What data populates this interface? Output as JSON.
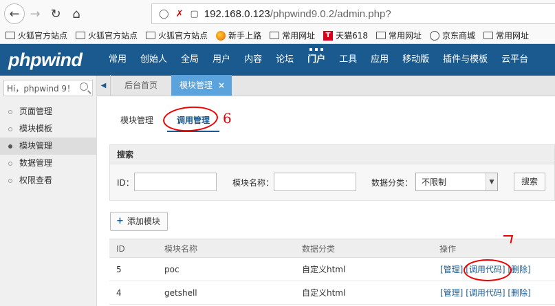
{
  "browser": {
    "url_host": "192.168.0.123",
    "url_path": "/phpwind9.0.2/admin.php?",
    "bookmarks": [
      {
        "label": "火狐官方站点",
        "icon": "folder-icon"
      },
      {
        "label": "火狐官方站点",
        "icon": "folder-icon"
      },
      {
        "label": "火狐官方站点",
        "icon": "folder-icon"
      },
      {
        "label": "新手上路",
        "icon": "firefox-icon"
      },
      {
        "label": "常用网址",
        "icon": "folder-icon"
      },
      {
        "label": "天猫618",
        "icon": "tmall-icon"
      },
      {
        "label": "常用网址",
        "icon": "folder-icon"
      },
      {
        "label": "京东商城",
        "icon": "globe-icon"
      },
      {
        "label": "常用网址",
        "icon": "folder-icon"
      }
    ]
  },
  "header": {
    "logo": "phpwind",
    "nav": [
      "常用",
      "创始人",
      "全局",
      "用户",
      "内容",
      "论坛",
      "门户",
      "工具",
      "应用",
      "移动版",
      "插件与模板",
      "云平台"
    ],
    "active_nav": "门户"
  },
  "sidebar": {
    "search_value": "Hi，phpwind 9！",
    "items": [
      {
        "label": "页面管理"
      },
      {
        "label": "模块模板"
      },
      {
        "label": "模块管理",
        "active": true
      },
      {
        "label": "数据管理"
      },
      {
        "label": "权限查看"
      }
    ]
  },
  "tabs": {
    "home": "后台首页",
    "active": "模块管理",
    "close": "×"
  },
  "subtabs": {
    "items": [
      "模块管理",
      "调用管理"
    ],
    "active": "调用管理"
  },
  "annotations": {
    "six": "6"
  },
  "search": {
    "title": "搜索",
    "id_label": "ID：",
    "name_label": "模块名称：",
    "category_label": "数据分类：",
    "category_value": "不限制",
    "button": "搜索"
  },
  "add_button": "添加模块",
  "table": {
    "headers": [
      "ID",
      "模块名称",
      "数据分类",
      "操作"
    ],
    "rows": [
      {
        "id": "5",
        "name": "poc",
        "category": "自定义html",
        "ops": [
          "[管理]",
          "[调用代码]",
          "[删除]"
        ]
      },
      {
        "id": "4",
        "name": "getshell",
        "category": "自定义html",
        "ops": [
          "[管理]",
          "[调用代码]",
          "[删除]"
        ]
      }
    ]
  },
  "colors": {
    "header_bg": "#1b5a8e",
    "active_tab": "#5aa3dc",
    "annotation": "#ee0000"
  }
}
